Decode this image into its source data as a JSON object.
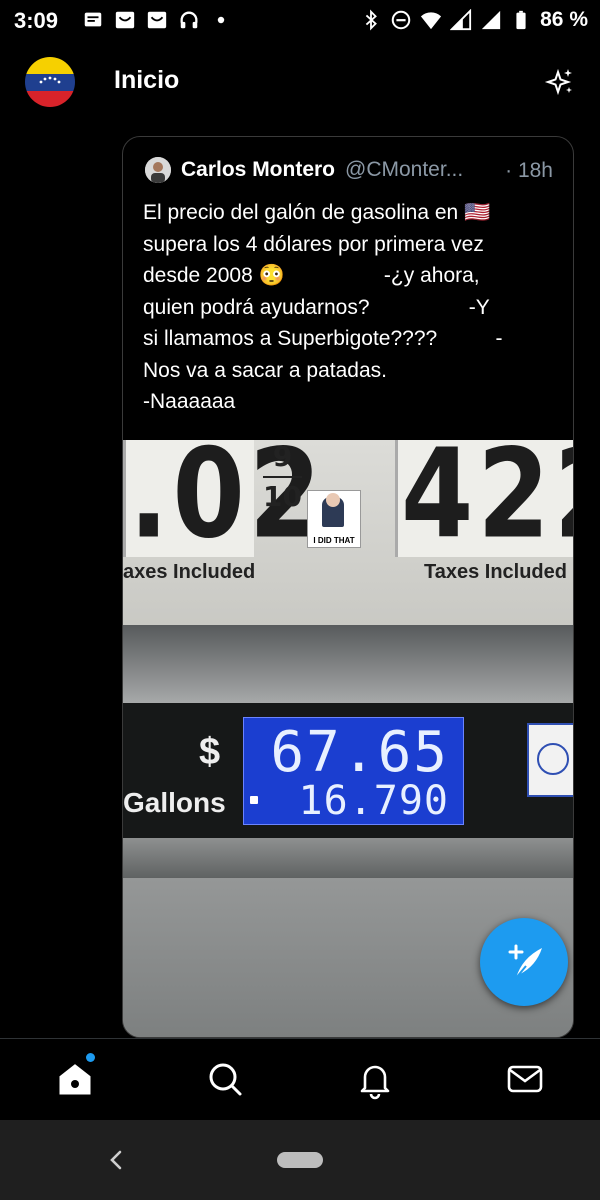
{
  "status_bar": {
    "time": "3:09",
    "battery": "86 %",
    "icons": [
      "message-icon",
      "mail-icon",
      "mail-icon",
      "headphones-icon",
      "dot-icon",
      "bluetooth-icon",
      "do-not-disturb-icon",
      "wifi-icon",
      "signal-icon",
      "signal-icon",
      "battery-icon"
    ]
  },
  "header": {
    "title": "Inicio",
    "avatar": "venezuela-flag-avatar",
    "sparkle": "sparkle-icon"
  },
  "tweet": {
    "author_name": "Carlos Montero",
    "author_handle": "@CMonter...",
    "time": "· 18h",
    "lines": [
      "El precio del galón de gasolina en 🇺🇸",
      "supera los 4 dólares por primera vez",
      "desde 2008 😳                 -¿y ahora,",
      "quien podrá ayudarnos?                 -Y",
      "si llamamos a Superbigote????          -",
      "Nos va a sacar a patadas.",
      "-Naaaaaa"
    ],
    "photo": {
      "left_price": ".02",
      "fraction_top": "9",
      "fraction_bottom": "10",
      "right_price": "422",
      "taxes_left": "axes Included",
      "taxes_right": "Taxes Included",
      "sticker_text": "I DID THAT",
      "dollar_label": "$",
      "gallons_label": "Gallons",
      "amount": "67.65",
      "gallons_value": "16.790"
    }
  },
  "bottom_nav": [
    {
      "name": "home",
      "icon": "home-icon"
    },
    {
      "name": "search",
      "icon": "search-icon"
    },
    {
      "name": "notifications",
      "icon": "bell-icon"
    },
    {
      "name": "messages",
      "icon": "mail-icon"
    }
  ],
  "colors": {
    "accent": "#1d9bf0",
    "background": "#000000",
    "secondary_text": "#8b98a5"
  }
}
